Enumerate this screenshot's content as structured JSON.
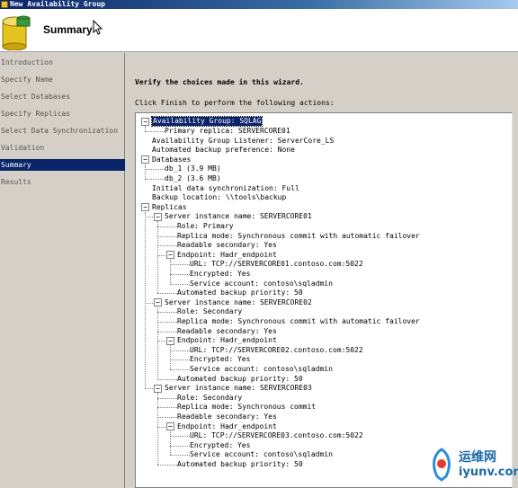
{
  "window": {
    "title": "New Availability Group"
  },
  "header": {
    "title": "Summary"
  },
  "sidebar": {
    "items": [
      {
        "label": "Introduction"
      },
      {
        "label": "Specify Name"
      },
      {
        "label": "Select Databases"
      },
      {
        "label": "Specify Replicas"
      },
      {
        "label": "Select Data Synchronization"
      },
      {
        "label": "Validation"
      },
      {
        "label": "Summary",
        "active": true
      },
      {
        "label": "Results"
      }
    ]
  },
  "main": {
    "heading": "Verify the choices made in this wizard.",
    "instruction": "Click Finish to perform the following actions:"
  },
  "tree": {
    "nodes": [
      {
        "text": "Availability Group: SQLAG",
        "level": 0,
        "expandable": true,
        "selected": true
      },
      {
        "text": "Primary replica: SERVERCORE01",
        "level": 1
      },
      {
        "text": "Availability Group Listener: ServerCore_LS",
        "level": 0
      },
      {
        "text": "Automated backup preference: None",
        "level": 0
      },
      {
        "text": "Databases",
        "level": 0,
        "expandable": true
      },
      {
        "text": "db_1 (3.9 MB)",
        "level": 1
      },
      {
        "text": "db_2 (3.6 MB)",
        "level": 1
      },
      {
        "text": "Initial data synchronization: Full",
        "level": 0
      },
      {
        "text": "Backup location: \\\\tools\\backup",
        "level": 0
      },
      {
        "text": "Replicas",
        "level": 0,
        "expandable": true
      },
      {
        "text": "Server instance name: SERVERCORE01",
        "level": 1,
        "expandable": true
      },
      {
        "text": "Role: Primary",
        "level": 2
      },
      {
        "text": "Replica mode: Synchronous commit with automatic failover",
        "level": 2
      },
      {
        "text": "Readable secondary: Yes",
        "level": 2
      },
      {
        "text": "Endpoint: Hadr_endpoint",
        "level": 2,
        "expandable": true
      },
      {
        "text": "URL: TCP://SERVERCORE01.contoso.com:5022",
        "level": 3
      },
      {
        "text": "Encrypted: Yes",
        "level": 3
      },
      {
        "text": "Service account: contoso\\sqladmin",
        "level": 3
      },
      {
        "text": "Automated backup priority: 50",
        "level": 2
      },
      {
        "text": "Server instance name: SERVERCORE02",
        "level": 1,
        "expandable": true
      },
      {
        "text": "Role: Secondary",
        "level": 2
      },
      {
        "text": "Replica mode: Synchronous commit with automatic failover",
        "level": 2
      },
      {
        "text": "Readable secondary: Yes",
        "level": 2
      },
      {
        "text": "Endpoint: Hadr_endpoint",
        "level": 2,
        "expandable": true
      },
      {
        "text": "URL: TCP://SERVERCORE02.contoso.com:5022",
        "level": 3
      },
      {
        "text": "Encrypted: Yes",
        "level": 3
      },
      {
        "text": "Service account: contoso\\sqladmin",
        "level": 3
      },
      {
        "text": "Automated backup priority: 50",
        "level": 2
      },
      {
        "text": "Server instance name: SERVERCORE03",
        "level": 1,
        "expandable": true
      },
      {
        "text": "Role: Secondary",
        "level": 2
      },
      {
        "text": "Replica mode: Synchronous commit",
        "level": 2
      },
      {
        "text": "Readable secondary: Yes",
        "level": 2
      },
      {
        "text": "Endpoint: Hadr_endpoint",
        "level": 2,
        "expandable": true
      },
      {
        "text": "URL: TCP://SERVERCORE03.contoso.com:5022",
        "level": 3
      },
      {
        "text": "Encrypted: Yes",
        "level": 3
      },
      {
        "text": "Service account: contoso\\sqladmin",
        "level": 3
      },
      {
        "text": "Automated backup priority: 50",
        "level": 2
      }
    ]
  },
  "watermark": {
    "brand": "运维网",
    "url": "iyunv.com"
  }
}
